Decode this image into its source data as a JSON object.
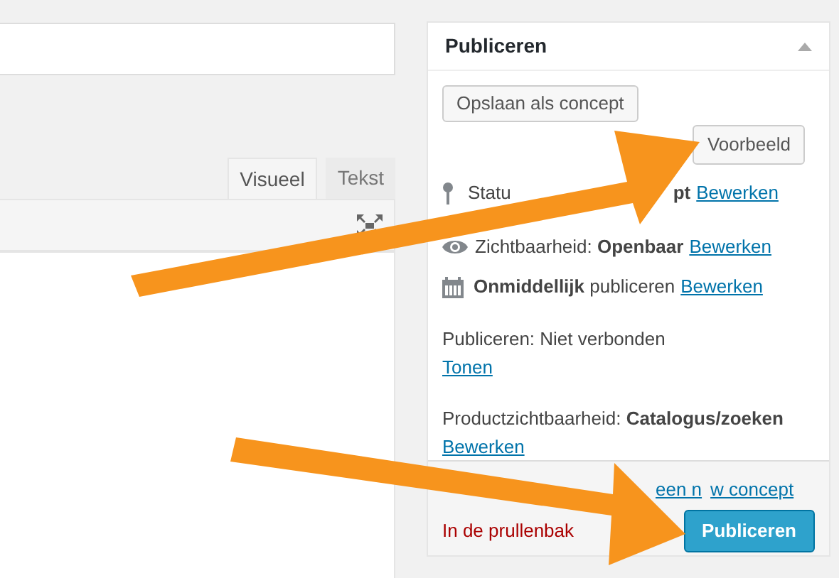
{
  "editor_tabs": [
    {
      "label": "Visueel",
      "selected": true
    },
    {
      "label": "Tekst",
      "selected": false
    }
  ],
  "publish_box": {
    "title": "Publiceren",
    "save_draft_button": "Opslaan als concept",
    "preview_button": "Voorbeeld",
    "status_row": {
      "label_fragments": [
        "Statu",
        "pt"
      ],
      "edit_link": "Bewerken"
    },
    "visibility_row": {
      "label": "Zichtbaarheid:",
      "value": "Openbaar",
      "edit_link": "Bewerken"
    },
    "schedule_row": {
      "value": "Onmiddellijk",
      "label": "publiceren",
      "edit_link": "Bewerken"
    },
    "publicize_row": {
      "label": "Publiceren: Niet verbonden",
      "link": "Tonen"
    },
    "product_visibility_row": {
      "label": "Productzichtbaarheid:",
      "value": "Catalogus/zoeken",
      "edit_link": "Bewerken"
    },
    "copy_link_fragments": [
      "een n",
      "w concept"
    ],
    "trash_link": "In de prullenbak",
    "publish_button": "Publiceren"
  }
}
